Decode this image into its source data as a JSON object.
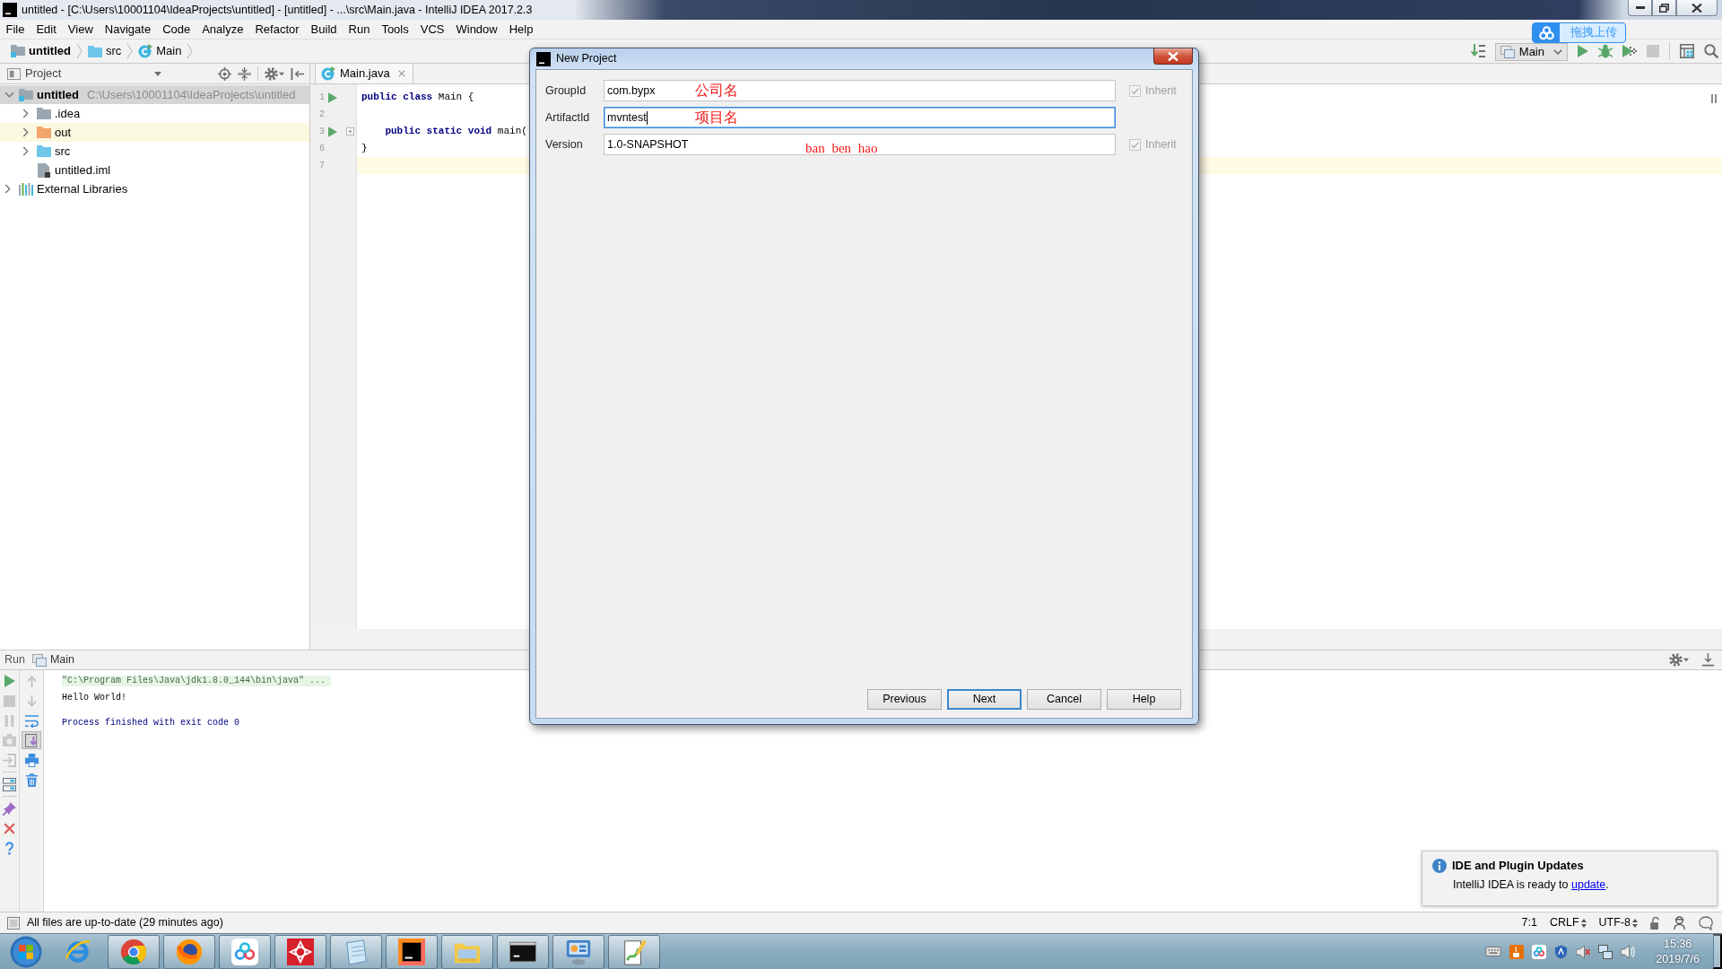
{
  "window": {
    "title": "untitled - [C:\\Users\\10001104\\IdeaProjects\\untitled] - [untitled] - ...\\src\\Main.java - IntelliJ IDEA 2017.2.3"
  },
  "menu": [
    "File",
    "Edit",
    "View",
    "Navigate",
    "Code",
    "Analyze",
    "Refactor",
    "Build",
    "Run",
    "Tools",
    "VCS",
    "Window",
    "Help"
  ],
  "breadcrumb": [
    {
      "label": "untitled",
      "kind": "module"
    },
    {
      "label": "src",
      "kind": "source_folder"
    },
    {
      "label": "Main",
      "kind": "class"
    }
  ],
  "run_config": {
    "label": "Main"
  },
  "upload_button": {
    "label": "拖拽上传"
  },
  "project_panel": {
    "title": "Project",
    "tree": [
      {
        "label": "untitled",
        "path": "C:\\Users\\10001104\\IdeaProjects\\untitled",
        "kind": "module",
        "expanded": true,
        "selected": true,
        "children": [
          {
            "label": ".idea",
            "kind": "folder",
            "expanded": false,
            "selected": false
          },
          {
            "label": "out",
            "kind": "excluded_folder",
            "expanded": false,
            "selected": false
          },
          {
            "label": "src",
            "kind": "source_folder",
            "expanded": false,
            "selected": false
          },
          {
            "label": "untitled.iml",
            "kind": "file",
            "selected": false
          }
        ]
      },
      {
        "label": "External Libraries",
        "kind": "libraries",
        "expanded": false,
        "selected": false
      }
    ]
  },
  "editor": {
    "tabs": [
      {
        "label": "Main.java",
        "selected": true
      }
    ],
    "lines": [
      {
        "number": "1",
        "code": "**public class** Main {",
        "run_marker": true,
        "folded": false,
        "current": false
      },
      {
        "number": "2",
        "run_marker": false,
        "folded": false,
        "current": false
      },
      {
        "number": "3",
        "code": "    **public static void** main(",
        "run_marker": true,
        "folded": true,
        "current": false
      },
      {
        "number": "6",
        "code": "}",
        "run_marker": false,
        "folded": false,
        "current": false
      },
      {
        "number": "7",
        "run_marker": false,
        "folded": false,
        "current": true
      }
    ]
  },
  "run_panel": {
    "title": "Run",
    "session": "Main",
    "console": [
      {
        "kind": "command",
        "text": "\"C:\\Program Files\\Java\\jdk1.8.0_144\\bin\\java\" ..."
      },
      {
        "kind": "output",
        "text": "Hello World!"
      },
      {
        "kind": "exit",
        "text": "Process finished with exit code 0"
      }
    ]
  },
  "status_bar": {
    "message": "All files are up-to-date (29 minutes ago)",
    "position": "7:1",
    "line_separator": "CRLF",
    "encoding": "UTF-8"
  },
  "notification": {
    "title": "IDE and Plugin Updates",
    "text": "IntelliJ IDEA is ready to",
    "link": "update",
    "suffix": "."
  },
  "dialog": {
    "title": "New Project",
    "fields": [
      {
        "label": "GroupId",
        "value": "com.bypx",
        "annotation": {
          "text": "公司名",
          "kind": "hanzi"
        },
        "focused": false,
        "inherit": {
          "label": "Inherit",
          "checked": true,
          "disabled": true
        }
      },
      {
        "label": "ArtifactId",
        "value": "mvntest",
        "annotation": {
          "text": "项目名",
          "kind": "hanzi"
        },
        "focused": true
      },
      {
        "label": "Version",
        "value": "1.0-SNAPSHOT",
        "annotation": {
          "text": "ban ben hao",
          "kind": "pinyin"
        },
        "focused": false,
        "inherit": {
          "label": "Inherit",
          "checked": true,
          "disabled": true
        }
      }
    ],
    "buttons": [
      {
        "label": "Previous",
        "default": false
      },
      {
        "label": "Next",
        "default": true
      },
      {
        "label": "Cancel",
        "default": false
      },
      {
        "label": "Help",
        "default": false
      }
    ]
  },
  "taskbar": {
    "time": "15:36",
    "date": "2019/7/6"
  }
}
